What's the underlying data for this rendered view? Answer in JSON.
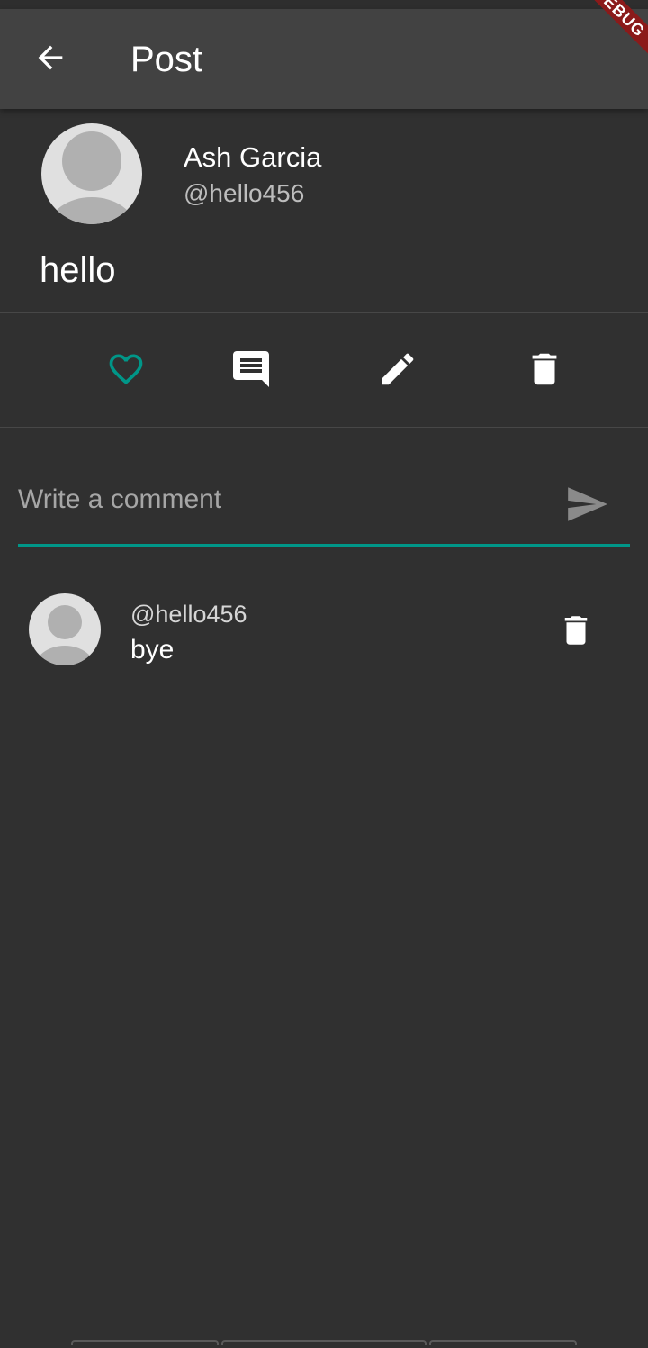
{
  "app_bar": {
    "title": "Post",
    "back_icon": "arrow-back-icon",
    "debug_banner": "DEBUG"
  },
  "post": {
    "author_name": "Ash Garcia",
    "author_handle": "@hello456",
    "body": "hello",
    "avatar_icon": "default-avatar-icon"
  },
  "actions": [
    {
      "icon": "heart-outline-icon",
      "color": "#009688"
    },
    {
      "icon": "comment-icon",
      "color": "#ffffff"
    },
    {
      "icon": "edit-pencil-icon",
      "color": "#ffffff"
    },
    {
      "icon": "trash-icon",
      "color": "#ffffff"
    }
  ],
  "comment_input": {
    "placeholder": "Write a comment",
    "value": "",
    "send_icon": "send-icon",
    "accent_color": "#009688"
  },
  "comments": [
    {
      "handle": "@hello456",
      "text": "bye",
      "delete_icon": "trash-icon"
    }
  ],
  "colors": {
    "background": "#303030",
    "app_bar": "#424242",
    "accent": "#009688",
    "debug_banner": "#8b1a1a"
  }
}
